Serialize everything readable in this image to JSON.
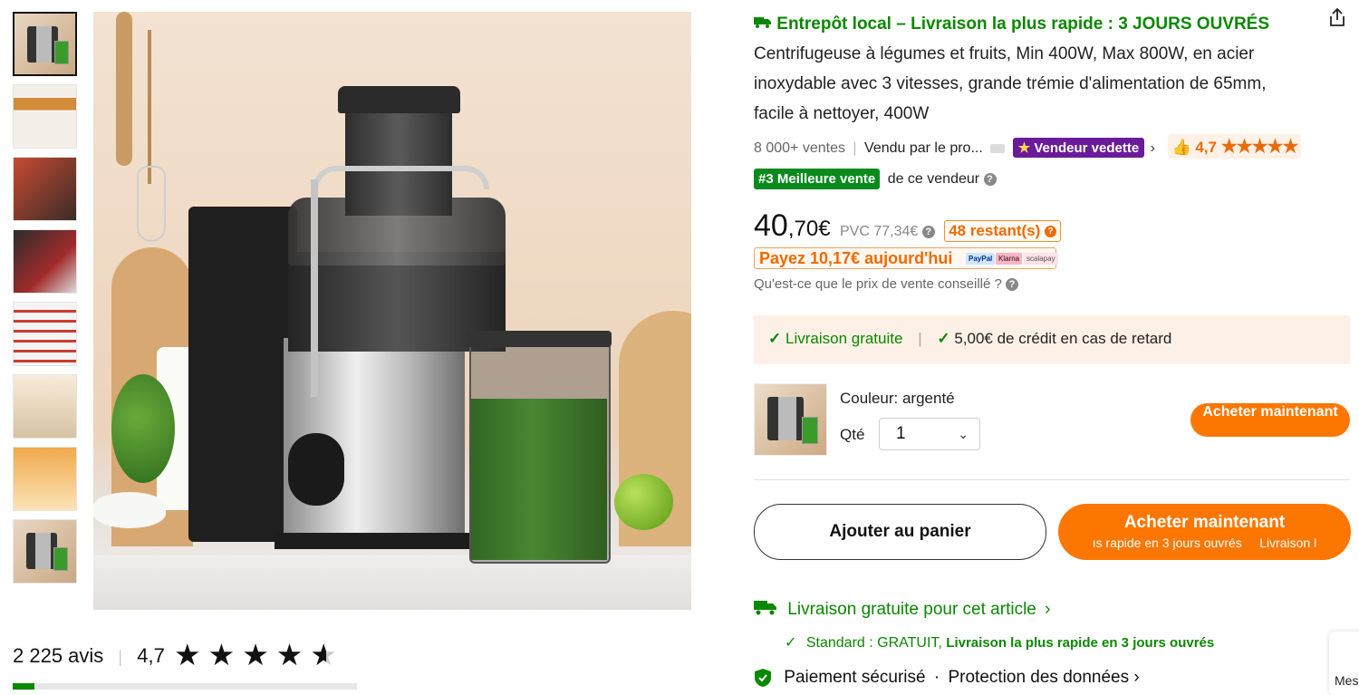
{
  "gallery": {
    "thumbnails": [
      "thumbnail-1",
      "thumbnail-2",
      "thumbnail-3",
      "thumbnail-4",
      "thumbnail-5",
      "thumbnail-6",
      "thumbnail-7",
      "thumbnail-8"
    ],
    "active_index": 0
  },
  "reviews": {
    "count_label": "2 225 avis",
    "separator": "|",
    "rating": "4,7",
    "stars": 4.7
  },
  "product": {
    "warehouse_label": "Entrepôt local – Livraison la plus rapide : 3 JOURS OUVRÉS",
    "title": "Centrifugeuse à légumes et fruits, Min 400W, Max 800W, en acier inoxydable avec 3 vitesses, grande trémie d'alimentation de 65mm, facile à nettoyer, 400W",
    "sales": "8 000+ ventes",
    "seller_prefix": "Vendu par le pro...",
    "seller_badge": "Vendeur vedette",
    "rating": "4,7",
    "rating_stars": 5,
    "best_seller_badge": "#3 Meilleure vente",
    "best_seller_suffix": "de ce vendeur"
  },
  "price": {
    "whole": "40",
    "cents": ",70€",
    "pvc_label": "PVC 77,34€",
    "stock": "48 restant(s)",
    "pay_today": "Payez 10,17€ aujourd'hui",
    "pay_logos": [
      "PayPal",
      "Klarna",
      "scalapay"
    ],
    "pvc_question": "Qu'est-ce que le prix de vente conseillé ?"
  },
  "delivery_band": {
    "free": "Livraison gratuite",
    "separator": "|",
    "credit": "5,00€ de crédit en cas de retard"
  },
  "variant": {
    "color_label": "Couleur: argenté",
    "qty_label": "Qté",
    "qty_value": "1",
    "buy_now_small": "Acheter maintenant"
  },
  "actions": {
    "add_to_cart": "Ajouter au panier",
    "buy_now": "Acheter maintenant",
    "buy_now_sub": "ıs rapide en 3 jours ouvrés     Livraison l"
  },
  "shipping": {
    "free_item": "Livraison gratuite pour cet article",
    "standard_prefix": "Standard : GRATUIT,",
    "standard_fast": "Livraison la plus rapide en 3 jours ouvrés",
    "secure_payment": "Paiement sécurisé",
    "data_protection": "Protection des données"
  },
  "side_tab": {
    "label": "Mes"
  },
  "colors": {
    "accent_orange": "#fb7701",
    "green": "#0a8800",
    "purple_badge": "#6a1b9a"
  }
}
